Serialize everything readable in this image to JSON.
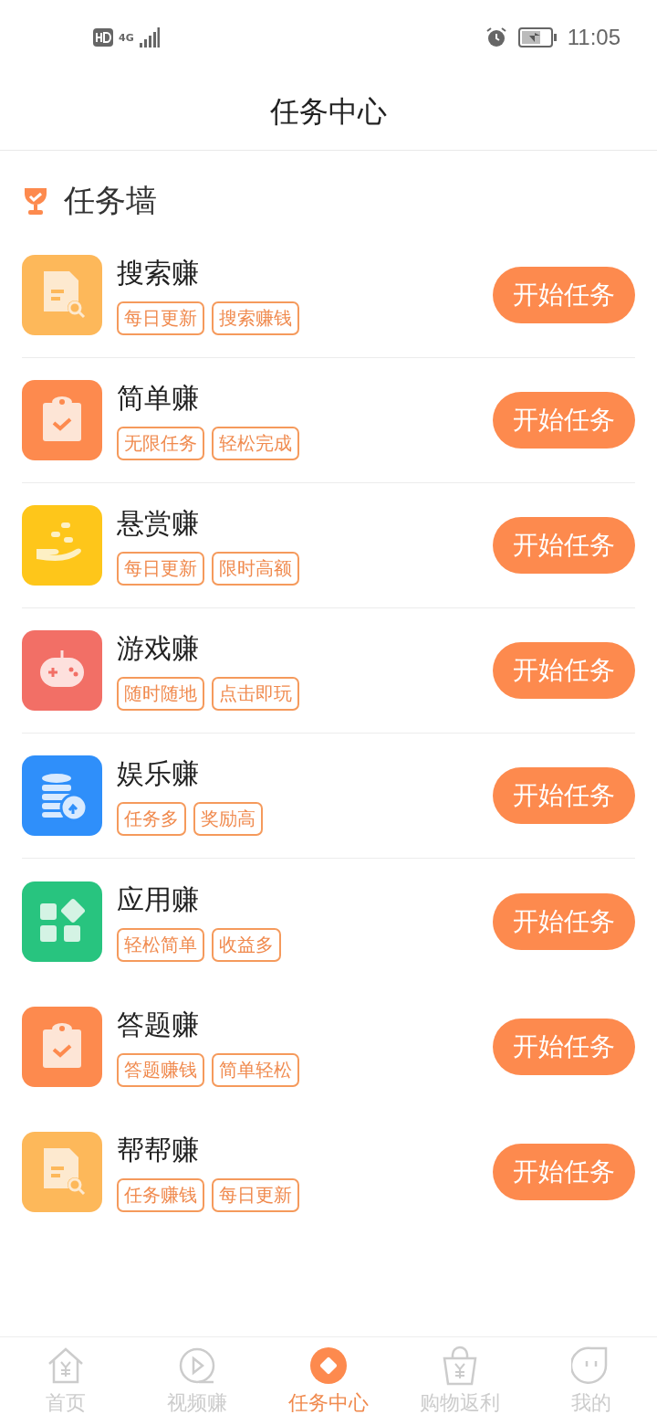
{
  "status_bar": {
    "network": "4G",
    "time": "11:05"
  },
  "header": {
    "title": "任务中心"
  },
  "section": {
    "title": "任务墙"
  },
  "tasks": [
    {
      "name": "搜索赚",
      "kind": "doc-search",
      "color": "#fdb85a",
      "tags": [
        "每日更新",
        "搜索赚钱"
      ],
      "button": "开始任务",
      "divider": true
    },
    {
      "name": "简单赚",
      "kind": "clipboard",
      "color": "#fd8a4e",
      "tags": [
        "无限任务",
        "轻松完成"
      ],
      "button": "开始任务",
      "divider": true
    },
    {
      "name": "悬赏赚",
      "kind": "hand",
      "color": "#fec61a",
      "tags": [
        "每日更新",
        "限时高额"
      ],
      "button": "开始任务",
      "divider": true
    },
    {
      "name": "游戏赚",
      "kind": "gamepad",
      "color": "#f26f66",
      "tags": [
        "随时随地",
        "点击即玩"
      ],
      "button": "开始任务",
      "divider": true
    },
    {
      "name": "娱乐赚",
      "kind": "coins",
      "color": "#2f8ffa",
      "tags": [
        "任务多",
        "奖励高"
      ],
      "button": "开始任务",
      "divider": true
    },
    {
      "name": "应用赚",
      "kind": "apps",
      "color": "#28c47f",
      "tags": [
        "轻松简单",
        "收益多"
      ],
      "button": "开始任务",
      "divider": false
    },
    {
      "name": "答题赚",
      "kind": "clipboard",
      "color": "#fd8a4e",
      "tags": [
        "答题赚钱",
        "简单轻松"
      ],
      "button": "开始任务",
      "divider": false
    },
    {
      "name": "帮帮赚",
      "kind": "doc-search",
      "color": "#fdb85a",
      "tags": [
        "任务赚钱",
        "每日更新"
      ],
      "button": "开始任务",
      "divider": false
    }
  ],
  "tabbar": [
    {
      "label": "首页",
      "kind": "home",
      "selected": false
    },
    {
      "label": "视频赚",
      "kind": "play",
      "selected": false
    },
    {
      "label": "任务中心",
      "kind": "task",
      "selected": true
    },
    {
      "label": "购物返利",
      "kind": "bag",
      "selected": false
    },
    {
      "label": "我的",
      "kind": "face",
      "selected": false
    }
  ]
}
